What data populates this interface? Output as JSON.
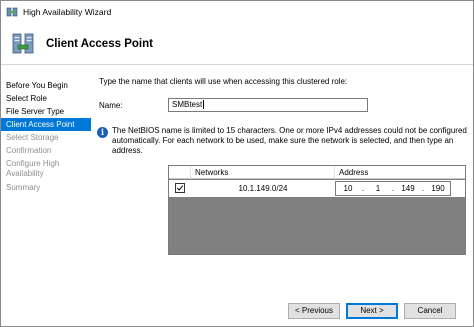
{
  "window": {
    "title": "High Availability Wizard"
  },
  "header": {
    "page_title": "Client Access Point"
  },
  "sidebar": {
    "steps": [
      {
        "label": "Before You Begin",
        "state": "normal"
      },
      {
        "label": "Select Role",
        "state": "normal"
      },
      {
        "label": "File Server Type",
        "state": "normal"
      },
      {
        "label": "Client Access Point",
        "state": "active"
      },
      {
        "label": "Select Storage",
        "state": "disabled"
      },
      {
        "label": "Confirmation",
        "state": "disabled"
      },
      {
        "label": "Configure High Availability",
        "state": "disabled"
      },
      {
        "label": "Summary",
        "state": "disabled"
      }
    ]
  },
  "main": {
    "instruction": "Type the name that clients will use when accessing this clustered role:",
    "name_label": "Name:",
    "name_value": "SMBtest",
    "info_text": "The NetBIOS name is limited to 15 characters.  One or more IPv4 addresses could not be configured automatically.  For each network to be used, make sure the network is selected, and then type an address.",
    "grid": {
      "columns": [
        "Networks",
        "Address"
      ],
      "rows": [
        {
          "checked": true,
          "network": "10.1.149.0/24",
          "address": [
            "10",
            "1",
            "149",
            "190"
          ]
        }
      ]
    }
  },
  "footer": {
    "previous_label": "< Previous",
    "next_label": "Next >",
    "cancel_label": "Cancel"
  },
  "colors": {
    "accent": "#0078d7",
    "grid_background": "#808080",
    "disabled_text": "#8f8f8f"
  },
  "icons": {
    "app": "cluster-wizard-icon",
    "header": "cluster-server-icon",
    "info": "info-icon",
    "checkbox": "checkmark-icon"
  }
}
